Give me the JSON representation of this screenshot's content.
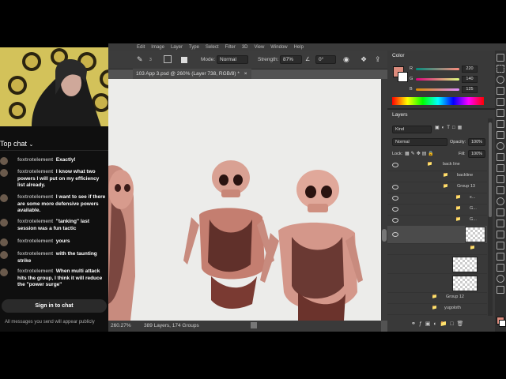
{
  "photoshop": {
    "menu": [
      "Edit",
      "Image",
      "Layer",
      "Type",
      "Select",
      "Filter",
      "3D",
      "View",
      "Window",
      "Help"
    ],
    "options": {
      "mode_label": "Mode:",
      "mode_value": "Normal",
      "strength_label": "Strength:",
      "strength_value": "87%",
      "angle_value": "0°",
      "brush_size": "3"
    },
    "doc_tab": "103 App 3.psd @ 260% (Layer 738, RGB/8) *",
    "status": {
      "zoom": "260.27%",
      "info": "389 Layers, 174 Groups"
    }
  },
  "color_panel": {
    "title": "Color",
    "r": {
      "label": "R",
      "value": "220"
    },
    "g": {
      "label": "G",
      "value": "140"
    },
    "b": {
      "label": "B",
      "value": "125"
    },
    "foreground": "#dc8c7d"
  },
  "layers_panel": {
    "title": "Layers",
    "filter_kind": "Kind",
    "blend_mode": "Normal",
    "opacity_label": "Opacity:",
    "opacity_value": "100%",
    "lock_label": "Lock:",
    "fill_label": "Fill:",
    "fill_value": "100%",
    "layers": [
      {
        "name": "back line"
      },
      {
        "name": "backline"
      },
      {
        "name": "Group 13"
      },
      {
        "name": "x..."
      },
      {
        "name": "G..."
      },
      {
        "name": "G..."
      },
      {
        "name": "Group 12"
      },
      {
        "name": "yugoloth"
      }
    ]
  },
  "chat": {
    "header": "Top chat",
    "messages": [
      {
        "user": "foxtrotelement",
        "text": "Exactly!"
      },
      {
        "user": "foxtrotelement",
        "text": "I know what two powers I will put on my efficiency list already."
      },
      {
        "user": "foxtrotelement",
        "text": "I want to see if there are some more defensive powers available."
      },
      {
        "user": "foxtrotelement",
        "text": "\"tanking\" last session was a fun tactic"
      },
      {
        "user": "foxtrotelement",
        "text": "yours"
      },
      {
        "user": "foxtrotelement",
        "text": "with the taunting strike"
      },
      {
        "user": "foxtrotelement",
        "text": "When multi attack hits the group, I think it will reduce the \"power surge\""
      }
    ],
    "signin_label": "Sign in to chat",
    "footer": "All messages you send will appear publicly"
  }
}
